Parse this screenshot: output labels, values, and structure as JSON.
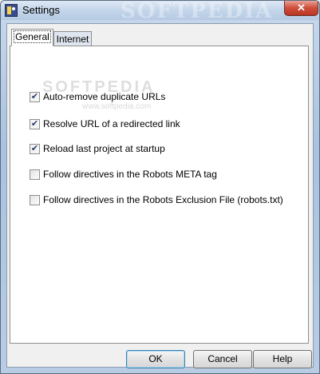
{
  "window": {
    "title": "Settings",
    "close_glyph": "✕",
    "watermark": "SOFTPEDIA"
  },
  "tabs": [
    {
      "label": "General",
      "active": true
    },
    {
      "label": "Internet",
      "active": false
    }
  ],
  "panel": {
    "watermark": "SOFTPEDIA",
    "watermark_url": "www.softpedia.com"
  },
  "options": [
    {
      "label": "Auto-remove duplicate URLs",
      "checked": true
    },
    {
      "label": "Resolve URL of a redirected link",
      "checked": true
    },
    {
      "label": "Reload last project at startup",
      "checked": true
    },
    {
      "label": "Follow directives in the Robots META tag",
      "checked": false
    },
    {
      "label": "Follow directives in the Robots Exclusion File (robots.txt)",
      "checked": false
    }
  ],
  "buttons": {
    "ok": "OK",
    "cancel": "Cancel",
    "help": "Help"
  },
  "check_glyph": "✔",
  "icons": {
    "app": "app-icon",
    "close": "close-icon",
    "checkbox": "checkbox-icon"
  }
}
